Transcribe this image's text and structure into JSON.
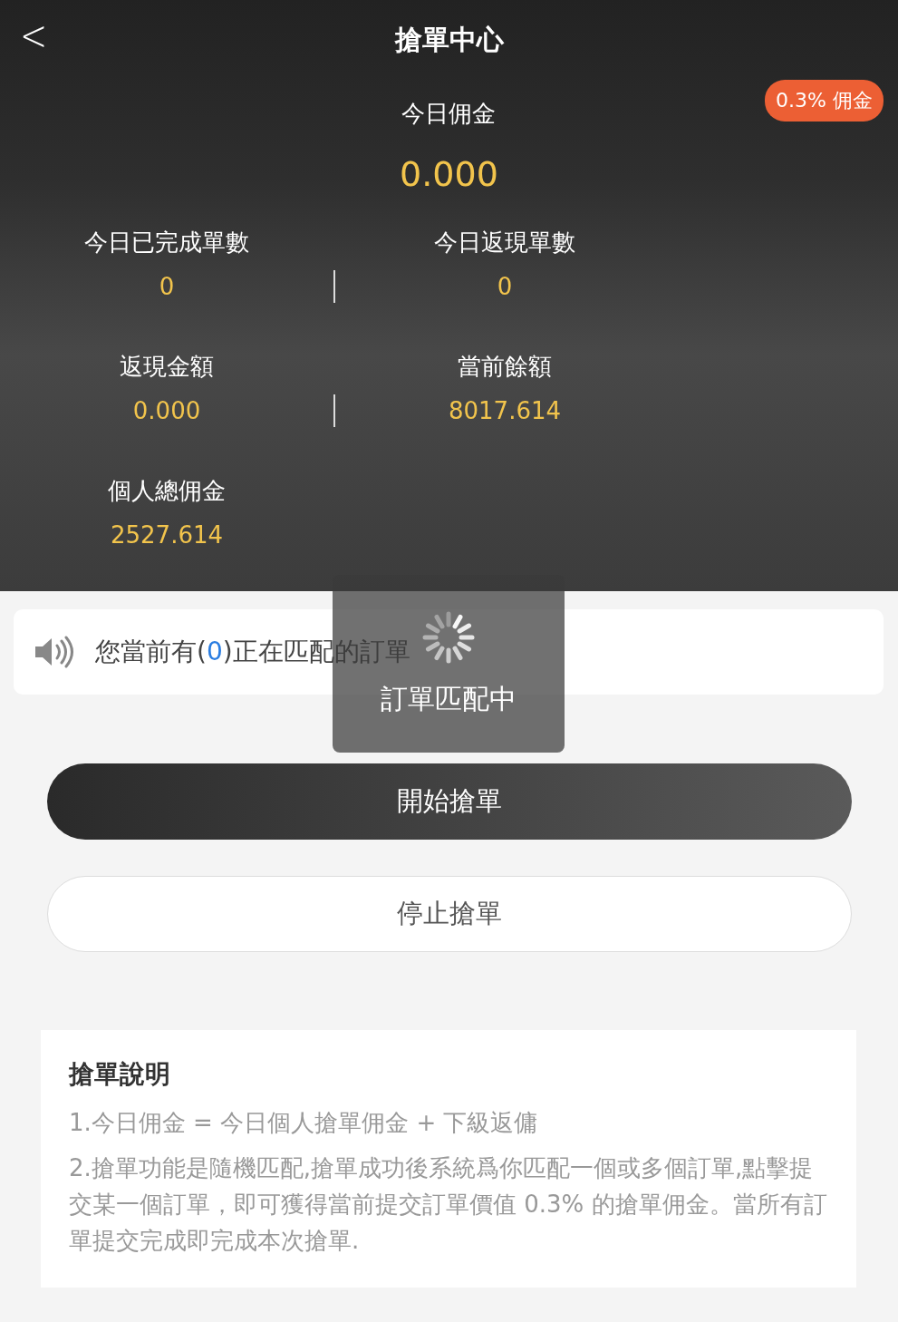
{
  "nav": {
    "back_glyph": "<",
    "title": "搶單中心"
  },
  "badge": "0.3% 佣金",
  "today_commission": {
    "label": "今日佣金",
    "value": "0.000"
  },
  "stats": [
    {
      "label": "今日已完成單數",
      "value": "0"
    },
    {
      "label": "今日返現單數",
      "value": "0"
    },
    {
      "label": "返現金額",
      "value": "0.000"
    },
    {
      "label": "當前餘額",
      "value": "8017.614"
    },
    {
      "label": "個人總佣金",
      "value": "2527.614"
    }
  ],
  "notice": {
    "before": "您當前有(",
    "count": "0",
    "after": ")正在匹配的訂單"
  },
  "toast": {
    "text": "訂單匹配中"
  },
  "buttons": [
    {
      "label": "開始搶單",
      "kind": "primary"
    },
    {
      "label": "停止搶單",
      "kind": "secondary"
    }
  ],
  "instructions": {
    "title": "搶單說明",
    "items": [
      "1.今日佣金 = 今日個人搶單佣金 + 下級返傭",
      "2.搶單功能是隨機匹配,搶單成功後系統爲你匹配一個或多個訂單,點擊提交某一個訂單，即可獲得當前提交訂單價值 0.3% 的搶單佣金。當所有訂單提交完成即完成本次搶單."
    ]
  }
}
